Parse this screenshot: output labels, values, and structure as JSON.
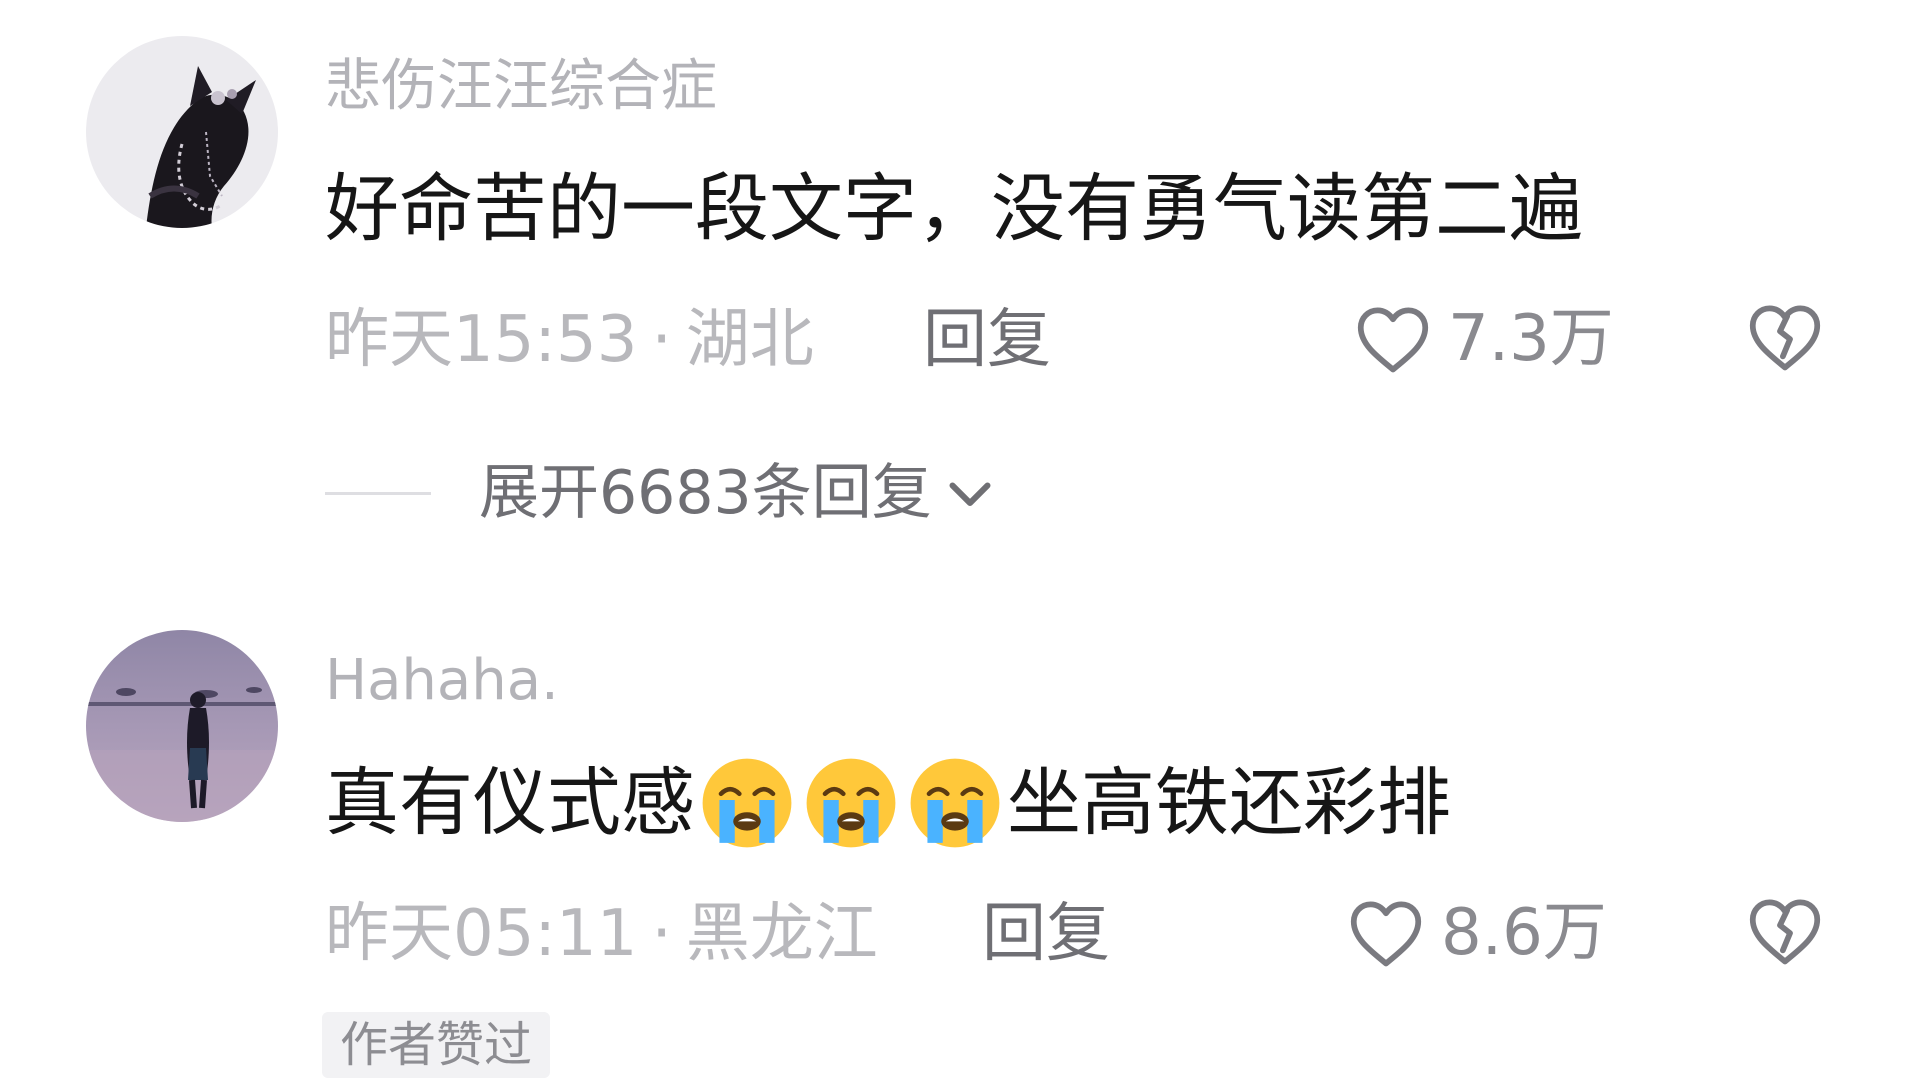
{
  "comments": [
    {
      "username": "悲伤汪汪综合症",
      "content": "好命苦的一段文字，没有勇气读第二遍",
      "time": "昨天15:53",
      "separator": "·",
      "location": "湖北",
      "reply_label": "回复",
      "like_count": "7.3万",
      "expand_replies_label": "展开6683条回复"
    },
    {
      "username": "Hahaha.",
      "content_before": "真有仪式感",
      "emojis": [
        "loudly-crying-face",
        "loudly-crying-face",
        "loudly-crying-face"
      ],
      "content_after": "坐高铁还彩排",
      "time": "昨天05:11",
      "separator": "·",
      "location": "黑龙江",
      "reply_label": "回复",
      "like_count": "8.6万",
      "badge": "作者赞过"
    }
  ],
  "colors": {
    "background": "#ffffff",
    "username": "#b3b3b8",
    "content": "#161616",
    "meta": "#b8b8bc",
    "action": "#6f6f74",
    "badge_bg": "#f2f2f4"
  },
  "icons": {
    "like": "heart-outline-icon",
    "dislike": "broken-heart-icon",
    "expand": "chevron-down-icon",
    "emoji": "loudly-crying-face-emoji"
  }
}
